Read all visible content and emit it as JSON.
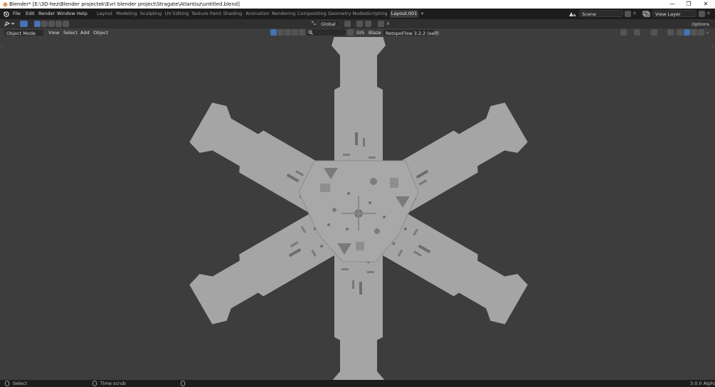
{
  "window": {
    "title": "Blender* [E:\\3D-hez\\Blender projectek\\Evri blender project\\Stragate\\Atlantisz\\untitled.blend]",
    "minimize_glyph": "—",
    "maximize_glyph": "❐",
    "close_glyph": "✕"
  },
  "menubar": {
    "menus": [
      "File",
      "Edit",
      "Render",
      "Window",
      "Help"
    ],
    "workspaces": [
      "Layout",
      "Modeling",
      "Sculpting",
      "UV Editing",
      "Texture Paint",
      "Shading",
      "Animation",
      "Rendering",
      "Compositing",
      "Geometry Nodes",
      "Scripting",
      "Layout.001"
    ],
    "active_workspace": "Layout.001",
    "add_workspace_glyph": "+",
    "scene": "Scene",
    "view_layer": "View Layer"
  },
  "toolheader": {
    "orientation": "Global",
    "options_label": "Options"
  },
  "viewheader": {
    "mode": "Object Mode",
    "menus": [
      "View",
      "Select",
      "Add",
      "Object"
    ],
    "addon_gis": "GIS",
    "addon_blaze": "Blaze",
    "retopoflow": "RetopoFlow 3.2.2 (self)"
  },
  "statusbar": {
    "select_label": "Select",
    "timescrub_label": "Time scrub",
    "version": "3.0.0 Alpha"
  },
  "colors": {
    "accent": "#4772b3",
    "viewport_bg": "#3d3d3d",
    "model_fill": "#a5a5a5",
    "detail": "#6e6e6e"
  }
}
